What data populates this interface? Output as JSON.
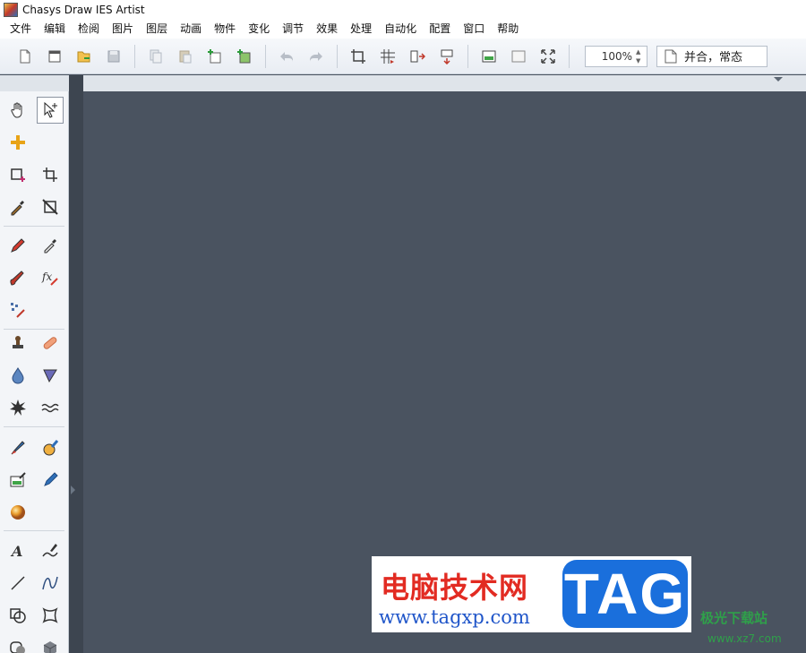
{
  "window": {
    "title": "Chasys Draw IES Artist"
  },
  "menu": [
    "文件",
    "编辑",
    "检阅",
    "图片",
    "图层",
    "动画",
    "物件",
    "变化",
    "调节",
    "效果",
    "处理",
    "自动化",
    "配置",
    "窗口",
    "帮助"
  ],
  "toolbar": {
    "zoom_value": "100%",
    "mode_label": "并合，常态",
    "icons": [
      "new-file-icon",
      "new-window-icon",
      "open-file-icon",
      "save-icon",
      "copy-icon",
      "paste-icon",
      "add-layer-icon",
      "add-layer-image-icon",
      "undo-icon",
      "redo-icon",
      "crop-canvas-icon",
      "grid-icon",
      "flip-horizontal-icon",
      "flip-vertical-icon",
      "image-view-icon",
      "blank-view-icon",
      "fullscreen-icon"
    ]
  },
  "tools": [
    "hand-icon",
    "select-arrow-icon",
    "move-cross-icon",
    "rect-select-icon",
    "crop-icon",
    "eyedropper-icon",
    "transform-icon",
    "pencil-icon",
    "color-picker-icon",
    "brush-icon",
    "fx-brush-icon",
    "pixel-brush-icon",
    "stamp-icon",
    "bandage-icon",
    "water-drop-icon",
    "triangle-shape-icon",
    "splatter-icon",
    "wave-icon",
    "paint-brush-icon",
    "paint-bucket-icon",
    "image-edit-icon",
    "pen-icon",
    "sphere-icon",
    "text-icon",
    "calligraphy-icon",
    "line-icon",
    "curve-icon",
    "shape-combine-icon",
    "warp-icon",
    "rounded-rect-icon",
    "cube-icon"
  ],
  "watermark": {
    "cn_text": "电脑技术网",
    "url_text": "www.tagxp.com",
    "tag_text": "TAG",
    "xz_title": "极光下载站",
    "xz_url": "www.xz7.com"
  },
  "colors": {
    "canvas_bg": "#4a5360",
    "toolbar_bg": "#eef1f5",
    "watermark_red": "#e22b22",
    "watermark_blue": "#1a6fdc",
    "watermark_green": "#2fa04a"
  }
}
